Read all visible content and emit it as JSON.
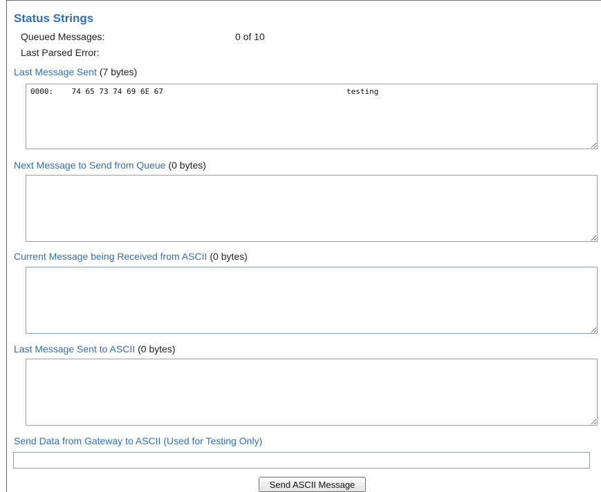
{
  "heading": "Status Strings",
  "status": {
    "queued_label": "Queued Messages:",
    "queued_value": "0 of 10",
    "error_label": "Last Parsed Error:",
    "error_value": ""
  },
  "sections": [
    {
      "label": "Last Message Sent",
      "bytes": "(7 bytes)",
      "content": "0000:    74 65 73 74 69 6E 67                                        testing"
    },
    {
      "label": "Next Message to Send from Queue",
      "bytes": "(0 bytes)",
      "content": ""
    },
    {
      "label": "Current Message being Received from ASCII",
      "bytes": "(0 bytes)",
      "content": ""
    },
    {
      "label": "Last Message Sent to ASCII",
      "bytes": "(0 bytes)",
      "content": ""
    }
  ],
  "send": {
    "label": "Send Data from Gateway to ASCII (Used for Testing Only)",
    "value": "",
    "button_label": "Send ASCII Message"
  }
}
